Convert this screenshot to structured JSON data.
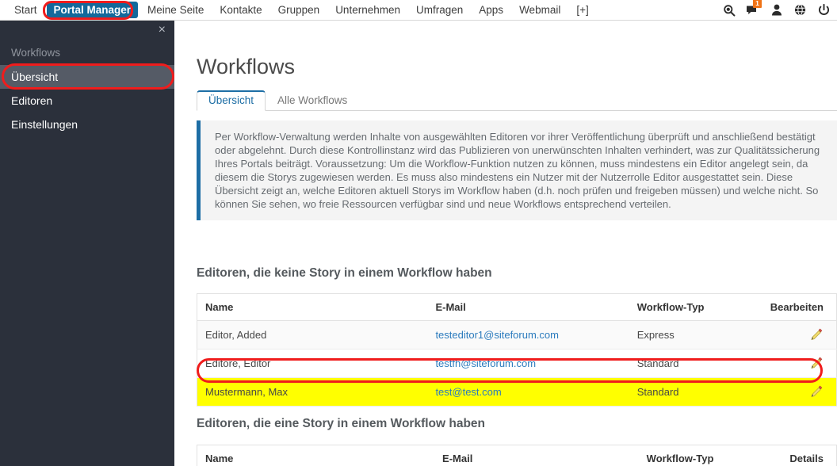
{
  "topnav": {
    "items": [
      {
        "label": "Start",
        "active": false
      },
      {
        "label": "Portal Manager",
        "active": true
      },
      {
        "label": "Meine Seite",
        "active": false
      },
      {
        "label": "Kontakte",
        "active": false
      },
      {
        "label": "Gruppen",
        "active": false
      },
      {
        "label": "Unternehmen",
        "active": false
      },
      {
        "label": "Umfragen",
        "active": false
      },
      {
        "label": "Apps",
        "active": false
      },
      {
        "label": "Webmail",
        "active": false
      },
      {
        "label": "[+]",
        "active": false
      }
    ],
    "icons": [
      {
        "name": "search-icon"
      },
      {
        "name": "messages-icon",
        "badge": "1"
      },
      {
        "name": "user-icon"
      },
      {
        "name": "globe-icon"
      },
      {
        "name": "power-icon"
      }
    ],
    "active_color": "#13699b",
    "badge_color": "#ef7317"
  },
  "sidebar": {
    "close_label": "×",
    "heading": "Workflows",
    "background": "#2b303b",
    "active_background": "#555b66",
    "items": [
      {
        "label": "Übersicht",
        "active": true
      },
      {
        "label": "Editoren",
        "active": false
      },
      {
        "label": "Einstellungen",
        "active": false
      }
    ]
  },
  "main": {
    "page_title": "Workflows",
    "tabs": [
      {
        "label": "Übersicht",
        "active": true
      },
      {
        "label": "Alle Workflows",
        "active": false
      }
    ],
    "accent_color": "#1d6ea5",
    "info_text": "Per Workflow-Verwaltung werden Inhalte von ausgewählten Editoren vor ihrer Veröffentlichung überprüft und anschließend bestätigt oder abgelehnt. Durch diese Kontrollinstanz wird das Publizieren von unerwünschten Inhalten verhindert, was zur Qualitätssicherung Ihres Portals beiträgt. Voraussetzung: Um die Workflow-Funktion nutzen zu können, muss mindestens ein Editor angelegt sein, da diesem die Storys zugewiesen werden. Es muss also mindestens ein Nutzer mit der Nutzerrolle Editor ausgestattet sein. Diese Übersicht zeigt an, welche Editoren aktuell Storys im Workflow haben (d.h. noch prüfen und freigeben müssen) und welche nicht. So können Sie sehen, wo freie Ressourcen verfügbar sind und neue Workflows entsprechend verteilen.",
    "section_no_story": {
      "heading": "Editoren, die keine Story in einem Workflow haben",
      "columns": [
        "Name",
        "E-Mail",
        "Workflow-Typ",
        "Bearbeiten"
      ],
      "rows": [
        {
          "name": "Editor, Added",
          "email": "testeditor1@siteforum.com",
          "type": "Express",
          "action_icon": "pencil-icon",
          "highlighted": false
        },
        {
          "name": "Editore, Editor",
          "email": "testfh@siteforum.com",
          "type": "Standard",
          "action_icon": "pencil-icon",
          "highlighted": false
        },
        {
          "name": "Mustermann, Max",
          "email": "test@test.com",
          "type": "Standard",
          "action_icon": "pencil-icon",
          "highlighted": true
        }
      ]
    },
    "section_with_story": {
      "heading": "Editoren, die eine Story in einem Workflow haben",
      "columns": [
        "Name",
        "E-Mail",
        "Workflow-Typ",
        "Details"
      ],
      "rows": []
    }
  },
  "annotations": {
    "color": "#f01c1c",
    "shapes": [
      "portal-manager-nav-highlight",
      "uebersicht-sidebar-highlight",
      "mustermann-row-highlight"
    ],
    "row_highlight_color": "#ffff00"
  }
}
